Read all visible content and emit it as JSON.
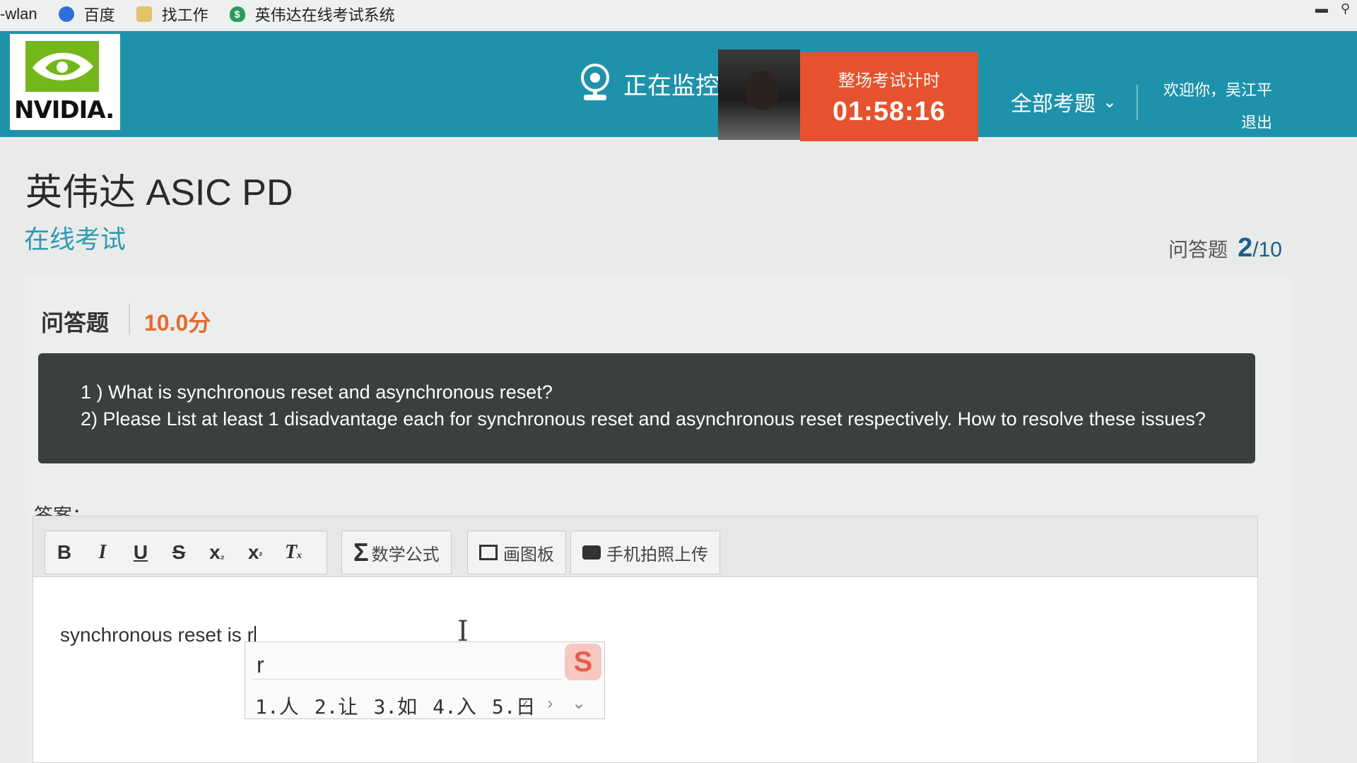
{
  "bookmarks": {
    "wlan": "-wlan",
    "baidu": "百度",
    "jobs": "找工作",
    "exam_site": "英伟达在线考试系统"
  },
  "header": {
    "logo_text": "NVIDIA.",
    "monitoring": "正在监控",
    "timer_label": "整场考试计时",
    "timer_value": "01:58:16",
    "all_questions": "全部考题",
    "welcome": "欢迎你，吴江平",
    "logout": "退出"
  },
  "exam": {
    "title": "英伟达 ASIC PD",
    "subtitle": "在线考试",
    "progress_label": "问答题",
    "progress_current": "2",
    "progress_total": "/10"
  },
  "question": {
    "type": "问答题",
    "score": "10.0分",
    "line1": "1 ) What is synchronous reset and asynchronous reset?",
    "line2": "2) Please List at least 1 disadvantage each for synchronous reset and asynchronous reset respectively. How to resolve these issues?"
  },
  "answer": {
    "label": "答案：",
    "toolbar": {
      "bold": "B",
      "italic": "I",
      "underline": "U",
      "strike": "S",
      "sub": "x",
      "sub_mark": "₂",
      "sup": "x",
      "sup_mark": "²",
      "clear": "T",
      "clear_mark": "x",
      "math_glyph": "Σ",
      "math": "数学公式",
      "draw": "画图板",
      "mobile": "手机拍照上传"
    },
    "content": "synchronous reset is r"
  },
  "ime": {
    "input": "r",
    "candidates": [
      "1.人",
      "2.让",
      "3.如",
      "4.入",
      "5.日"
    ],
    "logo": "S",
    "nav": "‹ › ⌄"
  },
  "colors": {
    "header_bg": "#1f92ab",
    "timer_bg": "#e5522d",
    "accent": "#2f9bb4",
    "score": "#e66a2d"
  }
}
